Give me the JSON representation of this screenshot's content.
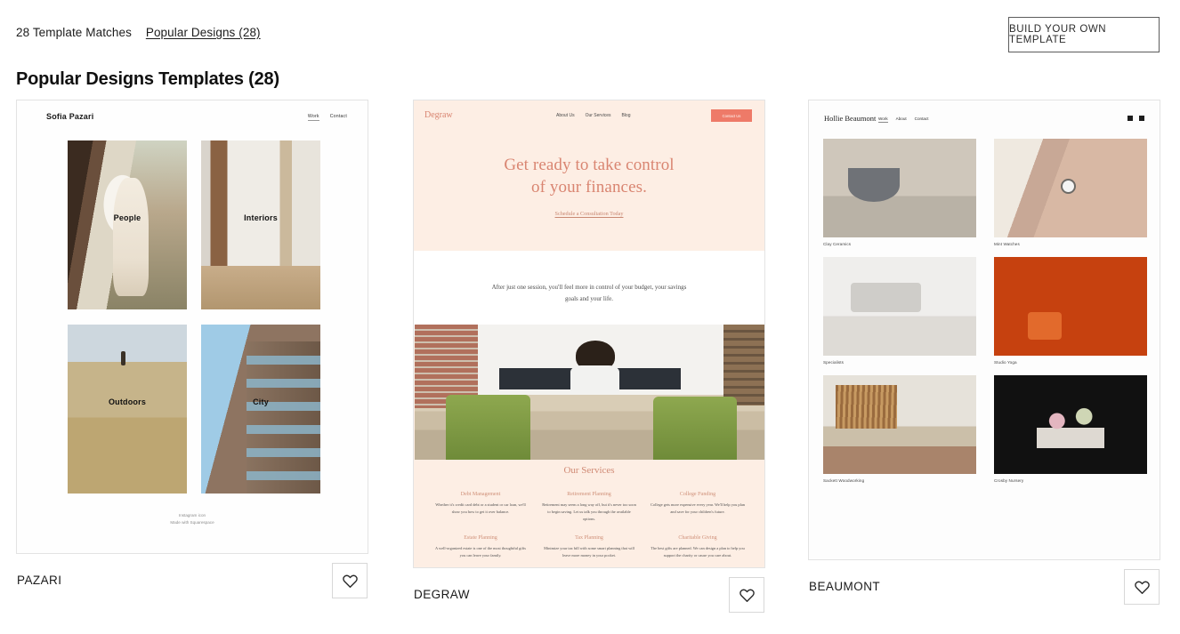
{
  "header": {
    "matches_count": "28 Template Matches",
    "category_link": "Popular Designs (28)",
    "build_button": "BUILD YOUR OWN TEMPLATE"
  },
  "page_title": "Popular Designs Templates (28)",
  "cards": [
    {
      "name": "PAZARI",
      "favorite_icon": "heart-icon",
      "preview": {
        "logo": "Sofia Pazari",
        "nav": [
          "Work",
          "Contact"
        ],
        "tiles": [
          {
            "caption": "People"
          },
          {
            "caption": "Interiors"
          },
          {
            "caption": "Outdoors"
          },
          {
            "caption": "City"
          }
        ],
        "footer_lines": [
          "Instagram icon",
          "Made with Squarespace"
        ]
      }
    },
    {
      "name": "DEGRAW",
      "favorite_icon": "heart-icon",
      "preview": {
        "logo": "Degraw",
        "nav": [
          "About Us",
          "Our Services",
          "Blog"
        ],
        "cta_button": "Contact Us",
        "hero_line1": "Get ready to take control",
        "hero_line2": "of your finances.",
        "hero_link": "Schedule a Consultation Today",
        "intro_paragraph": "After just one session, you'll feel more in control of your budget, your savings goals and your life.",
        "services_title": "Our Services",
        "services": [
          {
            "title": "Debt Management",
            "body": "Whether it's credit card debt or a student or car loan, we'll show you how to get it over balance."
          },
          {
            "title": "Retirement Planning",
            "body": "Retirement may seem a long way off, but it's never too soon to begin saving. Let us talk you through the available options."
          },
          {
            "title": "College Funding",
            "body": "College gets more expensive every year. We'll help you plan and save for your children's future."
          },
          {
            "title": "Estate Planning",
            "body": "A well-organized estate is one of the most thoughtful gifts you can leave your family."
          },
          {
            "title": "Tax Planning",
            "body": "Minimize your tax bill with some smart planning that will leave more money in your pocket."
          },
          {
            "title": "Charitable Giving",
            "body": "The best gifts are planned. We can design a plan to help you support the charity or cause you care about."
          }
        ]
      }
    },
    {
      "name": "BEAUMONT",
      "favorite_icon": "heart-icon",
      "preview": {
        "logo": "Hollie Beaumont",
        "nav": [
          "Work",
          "About",
          "Contact"
        ],
        "social_icons": [
          "instagram-icon",
          "twitter-icon"
        ],
        "items": [
          {
            "caption": "Clay Ceramics"
          },
          {
            "caption": "Mint Watches"
          },
          {
            "caption": "Specialists"
          },
          {
            "caption": "Studio Yoga"
          },
          {
            "caption": "Sackett Woodworking"
          },
          {
            "caption": "Crosby Nursery"
          }
        ]
      }
    }
  ],
  "colors": {
    "page_background": "#ffffff",
    "text": "#121212",
    "degraw_cream": "#fdeee4",
    "degraw_coral": "#ee7a68",
    "degraw_rose": "#d98571",
    "beaumont_orange": "#c6410f",
    "card_border": "#e3e3e3"
  }
}
